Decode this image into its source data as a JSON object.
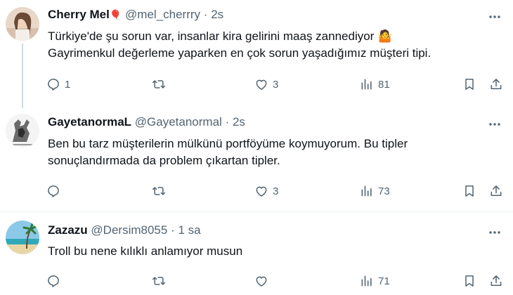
{
  "tweets": [
    {
      "name": "Cherry Mel",
      "name_emoji": "🎈",
      "handle": "@mel_cherrry",
      "dot": "·",
      "time": "2s",
      "lines": [
        "Türkiye'de şu sorun var, insanlar kira gelirini maaş zannediyor 🤷",
        "Gayrimenkul değerleme yaparken en çok sorun yaşadığımız müşteri tipi."
      ],
      "replies": "1",
      "retweets": "",
      "likes": "3",
      "views": "81"
    },
    {
      "name": "GayetanormaL",
      "handle": "@Gayetanormal",
      "dot": "·",
      "time": "2s",
      "lines": [
        "Ben bu tarz müşterilerin mülkünü portföyüme koymuyorum. Bu tipler",
        "sonuçlandırmada da problem çıkartan tipler."
      ],
      "replies": "",
      "retweets": "",
      "likes": "3",
      "views": "73"
    },
    {
      "name": "Zazazu",
      "handle": "@Dersim8055",
      "dot": "·",
      "time": "1 sa",
      "lines": [
        "Troll bu nene kılıklı anlamıyor musun"
      ],
      "replies": "",
      "retweets": "",
      "likes": "",
      "views": "71"
    }
  ],
  "colors": {
    "text": "#0f1419",
    "secondary": "#536471",
    "divider": "#eff3f4",
    "thread": "#cfd9de"
  },
  "icons": [
    "reply-icon",
    "retweet-icon",
    "like-icon",
    "views-icon",
    "bookmark-icon",
    "share-icon",
    "more-icon"
  ]
}
